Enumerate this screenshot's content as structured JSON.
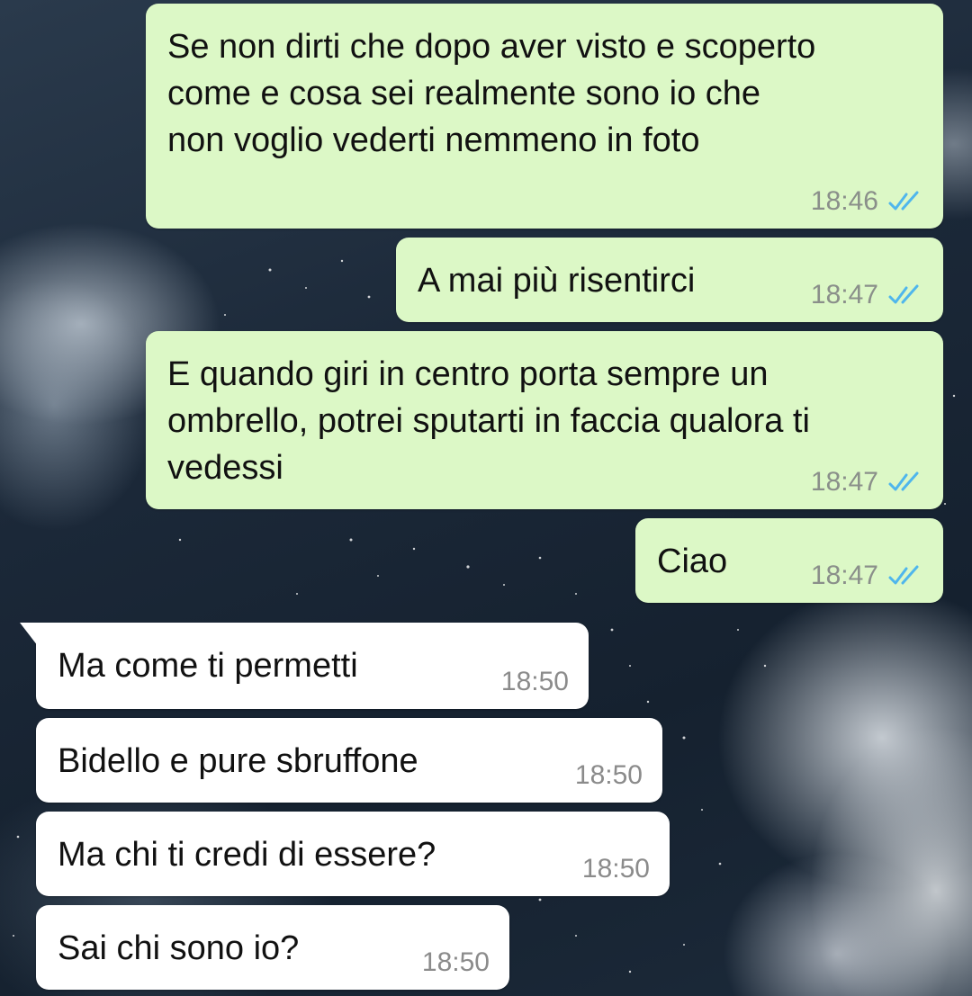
{
  "chat": {
    "messages": [
      {
        "direction": "outgoing",
        "text": "Se non dirti che dopo aver visto e scoperto\ncome e cosa sei realmente sono io che\nnon voglio vederti nemmeno in foto",
        "time": "18:46",
        "status": "read"
      },
      {
        "direction": "outgoing",
        "text": "A mai più risentirci",
        "time": "18:47",
        "status": "read"
      },
      {
        "direction": "outgoing",
        "text": "E quando giri in centro porta sempre un\nombrello, potrei sputarti in faccia qualora ti\nvedessi",
        "time": "18:47",
        "status": "read"
      },
      {
        "direction": "outgoing",
        "text": "Ciao",
        "time": "18:47",
        "status": "read"
      },
      {
        "direction": "incoming",
        "text": "Ma come ti permetti",
        "time": "18:50"
      },
      {
        "direction": "incoming",
        "text": "Bidello e pure sbruffone",
        "time": "18:50"
      },
      {
        "direction": "incoming",
        "text": "Ma chi ti credi di essere?",
        "time": "18:50"
      },
      {
        "direction": "incoming",
        "text": "Sai chi sono io?",
        "time": "18:50"
      }
    ]
  },
  "colors": {
    "outgoing_bubble": "#dcf8c6",
    "incoming_bubble": "#ffffff",
    "read_ticks": "#4fb6ec",
    "timestamp": "#8a8f8a"
  },
  "icons": {
    "read_status": "double-check-icon"
  }
}
